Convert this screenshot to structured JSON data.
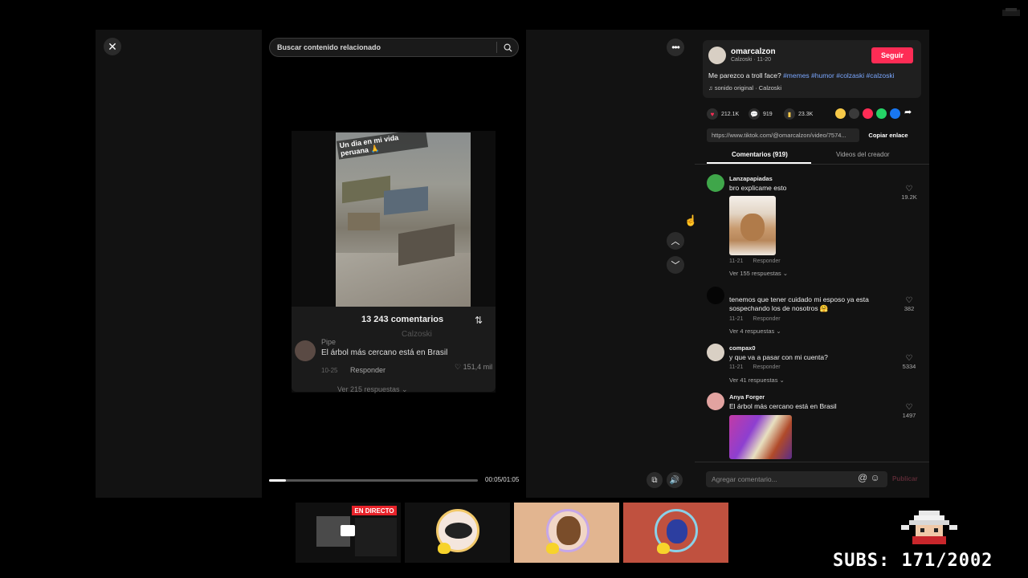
{
  "search": {
    "placeholder": "Buscar contenido relacionado"
  },
  "close_icon": "✕",
  "video": {
    "caption": "Un dia en mi vida peruana 🙏",
    "inner_comments": {
      "title": "13 243 comentarios",
      "subtitle": "Calzoski",
      "user": "Pipe",
      "text": "El árbol más cercano está en Brasil",
      "date": "10-25",
      "reply": "Responder",
      "likes": "151,4 mil",
      "more": "Ver 215 respuestas ⌄"
    },
    "progress": 0.08,
    "time": "00:05/01:05"
  },
  "author": {
    "username": "omarcalzon",
    "meta": "Calzoski · 11-20",
    "follow_label": "Seguir",
    "description": "Me parezco a troll face? ",
    "hashtags": "#memes #humor #colzaski #calzoski",
    "sound": "♫  sonido original · Calzoski"
  },
  "stats": {
    "likes": "212.1K",
    "comments": "919",
    "saves": "23.3K"
  },
  "link": {
    "url": "https://www.tiktok.com/@omarcalzon/video/7574...",
    "copy_label": "Copiar enlace"
  },
  "tabs": {
    "comments": "Comentarios (919)",
    "creator_videos": "Videos del creador"
  },
  "comments": [
    {
      "user": "Lanzapapiadas",
      "text": "bro explicame esto",
      "date": "11-21",
      "reply": "Responder",
      "likes": "19.2K",
      "more": "Ver 155 respuestas ⌄"
    },
    {
      "user": "",
      "text": "tenemos que tener cuidado mi esposo ya esta sospechando los de nosotros 🤗",
      "date": "11-21",
      "reply": "Responder",
      "likes": "382",
      "more": "Ver 4 respuestas ⌄"
    },
    {
      "user": "compax0",
      "text": "y que va a pasar con mi cuenta?",
      "date": "11-21",
      "reply": "Responder",
      "likes": "5334",
      "more": "Ver 41 respuestas ⌄"
    },
    {
      "user": "Anya Forger",
      "text": "El árbol más cercano está en Brasil",
      "likes": "1497"
    }
  ],
  "comment_input": {
    "placeholder": "Agregar comentario...",
    "publish": "Publicar"
  },
  "stream": {
    "live_badge": "EN DIRECTO",
    "subs": "SUBS: 171/2002"
  },
  "colors": {
    "accent": "#fe2c55",
    "hashtag": "#7aa7ff",
    "panel_bg": "#121212"
  }
}
